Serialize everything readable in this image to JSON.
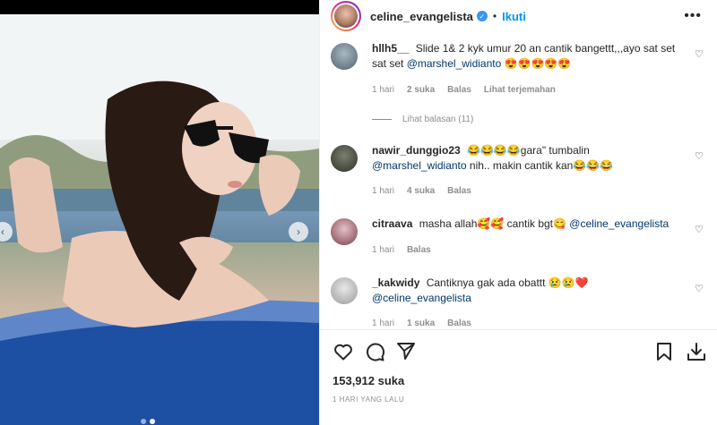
{
  "post": {
    "username": "celine_evangelista",
    "separator": "•",
    "follow_label": "Ikuti",
    "more_label": "•••",
    "likes": "153,912 suka",
    "time_ago": "1 HARI YANG LALU"
  },
  "comments": [
    {
      "user": "hllh5__",
      "text": "Slide 1& 2 kyk umur 20 an cantik bangettt,,,ayo sat set sat set",
      "mention": "@marshel_widianto",
      "emoji": "😍😍😍😍😍",
      "time": "1 hari",
      "likes": "2 suka",
      "reply": "Balas",
      "translate": "Lihat terjemahan",
      "view_replies": "Lihat balasan (11)"
    },
    {
      "user": "nawir_dunggio23",
      "text_before": "😂😂😂😂gara\" tumbalin",
      "mention": "@marshel_widianto",
      "text_after": "nih.. makin cantik kan😂😂😂",
      "time": "1 hari",
      "likes": "4 suka",
      "reply": "Balas"
    },
    {
      "user": "citraava",
      "text": "masha allah🥰🥰 cantik bgt😋",
      "mention": "@celine_evangelista",
      "time": "1 hari",
      "reply": "Balas"
    },
    {
      "user": "_kakwidy",
      "text": "Cantiknya gak ada obattt 😢😢❤️",
      "mention": "@celine_evangelista",
      "time": "1 hari",
      "likes": "1 suka",
      "reply": "Balas"
    }
  ],
  "icons": {
    "like": "heart-icon",
    "comment": "comment-icon",
    "share": "share-icon",
    "save": "bookmark-icon",
    "download": "download-icon",
    "verified": "verified-badge-icon"
  },
  "colors": {
    "accent": "#0095f6",
    "verified": "#3897f0",
    "mention": "#00376b",
    "muted": "#8e8e8e"
  }
}
